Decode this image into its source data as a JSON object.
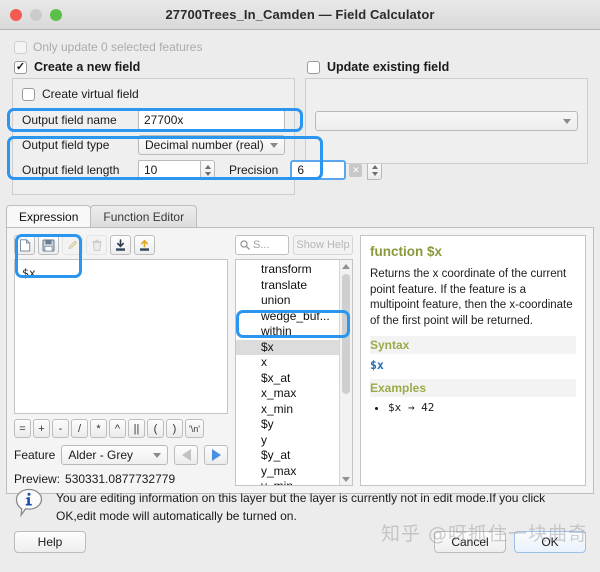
{
  "window": {
    "title": "27700Trees_In_Camden — Field Calculator",
    "traffic_lights": [
      "close-red",
      "minimize-gray",
      "zoom-green"
    ]
  },
  "options": {
    "only_update_selected_label": "Only update 0 selected features",
    "only_update_selected_checked": false,
    "create_new_field_label": "Create a new field",
    "create_new_field_checked": true,
    "update_existing_field_label": "Update existing field",
    "update_existing_field_checked": false,
    "create_virtual_field_label": "Create virtual field",
    "create_virtual_field_checked": false,
    "existing_field_value": ""
  },
  "output": {
    "name_label": "Output field name",
    "name_value": "27700x",
    "type_label": "Output field type",
    "type_value": "Decimal number (real)",
    "length_label": "Output field length",
    "length_value": "10",
    "precision_label": "Precision",
    "precision_value": "6"
  },
  "tabs": [
    {
      "label": "Expression",
      "active": true
    },
    {
      "label": "Function Editor",
      "active": false
    }
  ],
  "toolbar": [
    {
      "icon": "new-file-icon",
      "enabled": true
    },
    {
      "icon": "save-icon",
      "enabled": true
    },
    {
      "icon": "edit-pencil-icon",
      "enabled": false
    },
    {
      "icon": "trash-icon",
      "enabled": false
    },
    {
      "icon": "import-down-arrow-icon",
      "enabled": true
    },
    {
      "icon": "export-up-arrow-icon",
      "enabled": true
    }
  ],
  "expression": {
    "value": "$x",
    "operators": [
      "=",
      "+",
      "-",
      "/",
      "*",
      "^",
      "||",
      "(",
      ")",
      "'\\n'"
    ],
    "feature_label": "Feature",
    "feature_value": "Alder - Grey",
    "prev_enabled": false,
    "next_enabled": true,
    "preview_label": "Preview:",
    "preview_value": "530331.0877732779"
  },
  "functions": {
    "search_placeholder": "S...",
    "search_value": "",
    "show_help_label": "Show Help",
    "show_help_enabled": false,
    "items": [
      {
        "label": "transform",
        "selected": false
      },
      {
        "label": "translate",
        "selected": false
      },
      {
        "label": "union",
        "selected": false
      },
      {
        "label": "wedge_buf...",
        "selected": false
      },
      {
        "label": "within",
        "selected": false
      },
      {
        "label": "$x",
        "selected": true
      },
      {
        "label": "x",
        "selected": false
      },
      {
        "label": "$x_at",
        "selected": false
      },
      {
        "label": "x_max",
        "selected": false
      },
      {
        "label": "x_min",
        "selected": false
      },
      {
        "label": "$y",
        "selected": false
      },
      {
        "label": "y",
        "selected": false
      },
      {
        "label": "$y_at",
        "selected": false
      },
      {
        "label": "y_max",
        "selected": false
      },
      {
        "label": "y_min",
        "selected": false
      }
    ]
  },
  "help": {
    "title": "function $x",
    "description": "Returns the x coordinate of the current point feature. If the feature is a multipoint feature, then the x-coordinate of the first point will be returned.",
    "syntax_heading": "Syntax",
    "syntax_value": "$x",
    "examples_heading": "Examples",
    "examples": [
      "$x → 42"
    ]
  },
  "footer": {
    "icon": "info-balloon-icon",
    "message": "You are editing information on this layer but the layer is currently not in edit mode.If you click OK,edit mode will automatically be turned on.",
    "help_label": "Help",
    "cancel_label": "Cancel",
    "ok_label": "OK"
  },
  "watermark": "知乎 @呀抓住一块曲奇",
  "colors": {
    "annotation": "#2b96f0",
    "help_heading": "#8a9a3b",
    "syntax": "#1f6fb5",
    "accent_blue": "#4a90e2"
  }
}
